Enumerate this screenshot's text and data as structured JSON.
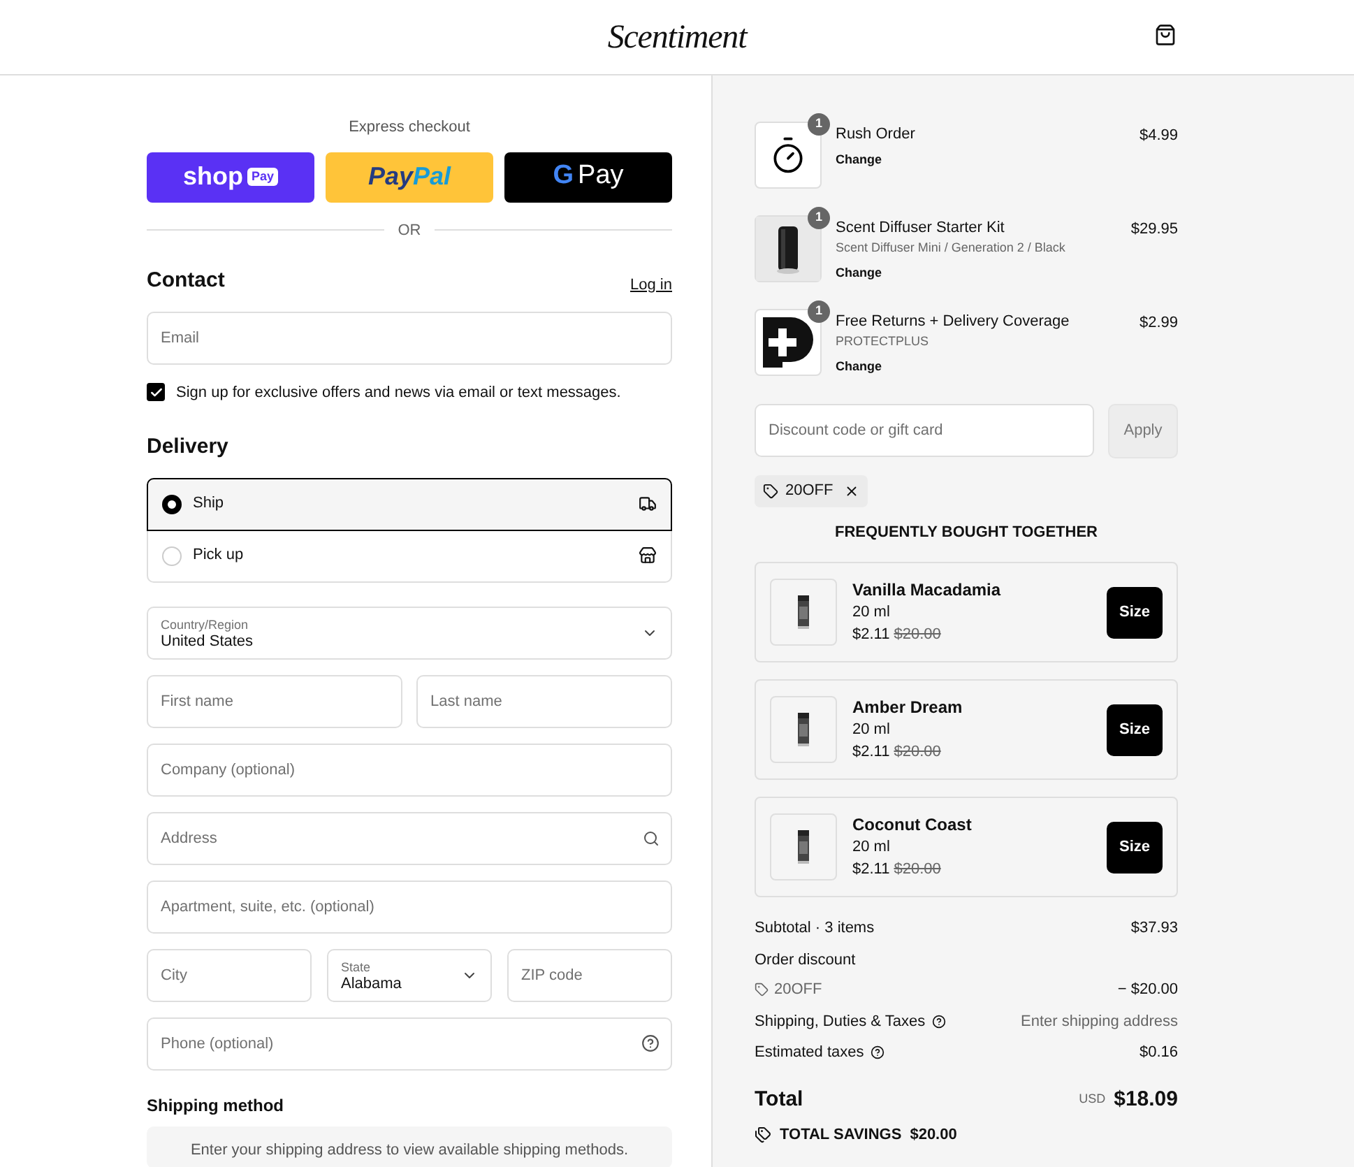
{
  "header": {
    "logo": "Scentiment"
  },
  "express": {
    "label": "Express checkout",
    "shop": "shop",
    "shop_badge": "Pay",
    "paypal_a": "Pay",
    "paypal_b": "Pal",
    "gpay_g": "G",
    "gpay": "Pay",
    "divider": "OR"
  },
  "contact": {
    "title": "Contact",
    "login": "Log in",
    "email": {
      "placeholder": "Email"
    },
    "newsletter": {
      "label": "Sign up for exclusive offers and news via email or text messages.",
      "checked": true
    }
  },
  "delivery": {
    "title": "Delivery",
    "options": [
      {
        "label": "Ship",
        "kind": "ship",
        "selected": true
      },
      {
        "label": "Pick up",
        "kind": "pickup",
        "selected": false
      }
    ]
  },
  "address": {
    "country": {
      "label": "Country/Region",
      "value": "United States"
    },
    "first_name": {
      "placeholder": "First name"
    },
    "last_name": {
      "placeholder": "Last name"
    },
    "company": {
      "placeholder": "Company (optional)"
    },
    "address": {
      "placeholder": "Address"
    },
    "apartment": {
      "placeholder": "Apartment, suite, etc. (optional)"
    },
    "city": {
      "placeholder": "City"
    },
    "state": {
      "label": "State",
      "value": "Alabama"
    },
    "zip": {
      "placeholder": "ZIP code"
    },
    "phone": {
      "placeholder": "Phone (optional)"
    }
  },
  "shipping_method": {
    "title": "Shipping method",
    "notice": "Enter your shipping address to view available shipping methods."
  },
  "cart": [
    {
      "kind": "timer",
      "qty": "1",
      "name": "Rush Order",
      "change": "Change",
      "price": "$4.99"
    },
    {
      "kind": "diffuser",
      "qty": "1",
      "name": "Scent Diffuser Starter Kit",
      "variant": "Scent Diffuser Mini / Generation 2 / Black",
      "change": "Change",
      "price": "$29.95"
    },
    {
      "kind": "protect",
      "qty": "1",
      "name": "Free Returns + Delivery Coverage",
      "variant": "PROTECTPLUS",
      "change": "Change",
      "price": "$2.99"
    }
  ],
  "discount": {
    "placeholder": "Discount code or gift card",
    "apply": "Apply",
    "code": "20OFF"
  },
  "fbt": {
    "title": "FREQUENTLY BOUGHT TOGETHER",
    "items": [
      {
        "name": "Vanilla Macadamia",
        "size": "20 ml",
        "price": "$2.11",
        "old_price": "$20.00",
        "button": "Size"
      },
      {
        "name": "Amber Dream",
        "size": "20 ml",
        "price": "$2.11",
        "old_price": "$20.00",
        "button": "Size"
      },
      {
        "name": "Coconut Coast",
        "size": "20 ml",
        "price": "$2.11",
        "old_price": "$20.00",
        "button": "Size"
      }
    ]
  },
  "summary": {
    "subtotal_label": "Subtotal · 3 items",
    "subtotal": "$37.93",
    "discount_label": "Order discount",
    "discount_code": "20OFF",
    "discount": "− $20.00",
    "shipping_label": "Shipping, Duties & Taxes",
    "shipping": "Enter shipping address",
    "taxes_label": "Estimated taxes",
    "taxes": "$0.16",
    "total_label": "Total",
    "currency": "USD",
    "total": "$18.09",
    "savings_label": "TOTAL SAVINGS",
    "savings": "$20.00"
  }
}
